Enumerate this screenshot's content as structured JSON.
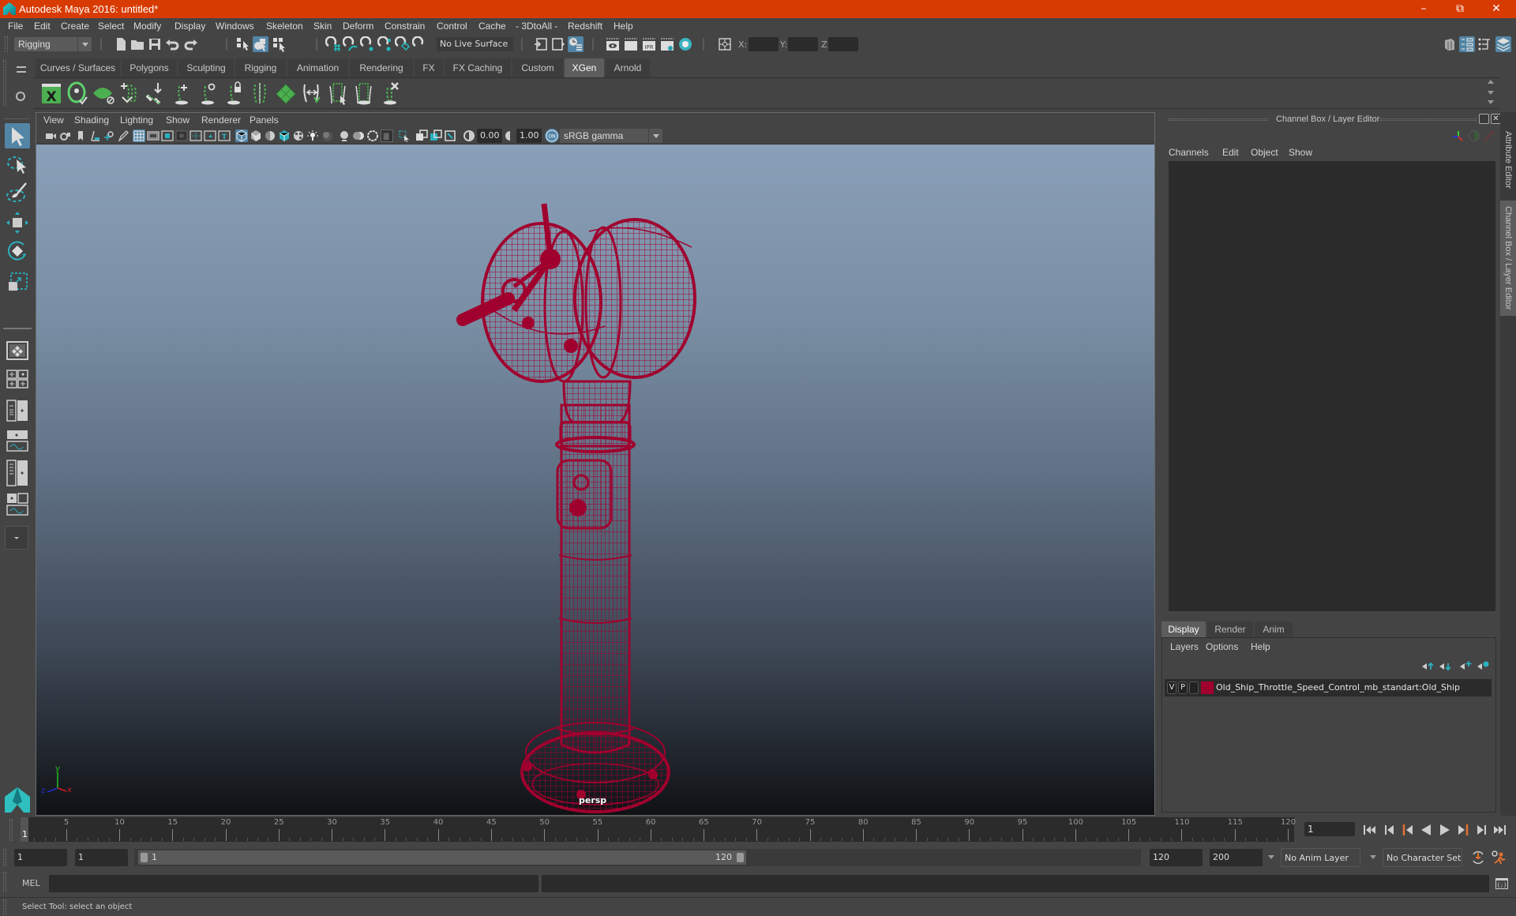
{
  "window": {
    "title": "Autodesk Maya 2016: untitled*",
    "controls": [
      "minimize",
      "restore",
      "close"
    ]
  },
  "menubar": [
    "File",
    "Edit",
    "Create",
    "Select",
    "Modify",
    "Display",
    "Windows",
    "Skeleton",
    "Skin",
    "Deform",
    "Constrain",
    "Control",
    "Cache",
    "- 3DtoAll -",
    "Redshift",
    "Help"
  ],
  "statusline": {
    "menuset": "Rigging",
    "live_surface": "No Live Surface",
    "x_label": "X:",
    "y_label": "Y:",
    "z_label": "Z:",
    "x_value": "",
    "y_value": "",
    "z_value": ""
  },
  "shelf": {
    "tabs": [
      "Curves / Surfaces",
      "Polygons",
      "Sculpting",
      "Rigging",
      "Animation",
      "Rendering",
      "FX",
      "FX Caching",
      "Custom",
      "XGen",
      "Arnold"
    ],
    "active_tab": "XGen",
    "icons": [
      "xgen-editor-icon",
      "toggle-preview-icon",
      "clear-preview-icon",
      "add-guides-icon",
      "place-guides-icon",
      "add-guide-icon",
      "sculpt-guide-icon",
      "lock-guide-icon",
      "bend-guides-icon",
      "groom-icon",
      "rebuild-guides-icon",
      "select-guides-icon",
      "guide-box-icon",
      "delete-guides-icon"
    ]
  },
  "viewport": {
    "menu": [
      "View",
      "Shading",
      "Lighting",
      "Show",
      "Renderer",
      "Panels"
    ],
    "exposure": "0.00",
    "gamma": "1.00",
    "color_space": "sRGB gamma",
    "camera": "persp",
    "wireframe_color": "#a0002e"
  },
  "channelbox": {
    "title": "Channel Box / Layer Editor",
    "menu": [
      "Channels",
      "Edit",
      "Object",
      "Show"
    ],
    "layer_tabs": [
      "Display",
      "Render",
      "Anim"
    ],
    "active_layer_tab": "Display",
    "layer_menu": [
      "Layers",
      "Options",
      "Help"
    ],
    "layers": [
      {
        "visible": "V",
        "playback": "P",
        "color": "#a0002e",
        "name": "Old_Ship_Throttle_Speed_Control_mb_standart:Old_Ship"
      }
    ]
  },
  "side_tabs": [
    "Attribute Editor",
    "Channel Box / Layer Editor"
  ],
  "timeline": {
    "ticks": [
      5,
      10,
      15,
      20,
      25,
      30,
      35,
      40,
      45,
      50,
      55,
      60,
      65,
      70,
      75,
      80,
      85,
      90,
      95,
      100,
      105,
      110,
      115,
      120
    ],
    "current_frame": "1",
    "current_frame_field": "1",
    "start": 1,
    "end": 120
  },
  "range": {
    "start_time": "1",
    "playback_start": "1",
    "range_start_label": "1",
    "range_end_label": "120",
    "playback_end": "120",
    "end_time": "200",
    "anim_layer": "No Anim Layer",
    "character_set": "No Character Set"
  },
  "commandline": {
    "label": "MEL",
    "value": ""
  },
  "helpline": "Select Tool: select an object"
}
